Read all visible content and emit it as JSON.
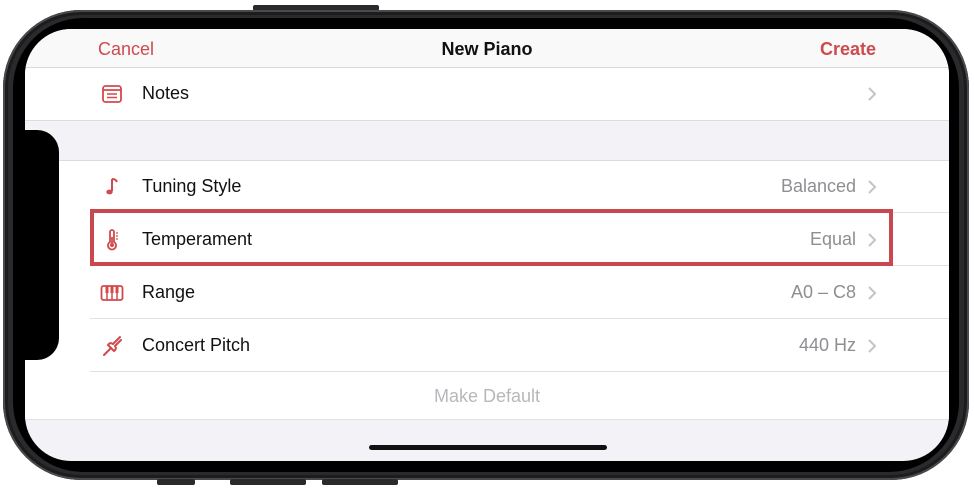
{
  "nav": {
    "cancel": "Cancel",
    "title": "New Piano",
    "create": "Create"
  },
  "sections": {
    "top": [
      {
        "label": "Notes",
        "icon": "notes-icon"
      }
    ],
    "settings": [
      {
        "label": "Tuning Style",
        "value": "Balanced",
        "icon": "music-note-icon"
      },
      {
        "label": "Temperament",
        "value": "Equal",
        "icon": "thermometer-icon"
      },
      {
        "label": "Range",
        "value": "A0 – C8",
        "icon": "piano-keys-icon"
      },
      {
        "label": "Concert Pitch",
        "value": "440 Hz",
        "icon": "tuning-fork-icon"
      }
    ]
  },
  "footer": {
    "make_default": "Make Default"
  },
  "colors": {
    "accent": "#d0494d",
    "highlight": "#c9474e"
  }
}
